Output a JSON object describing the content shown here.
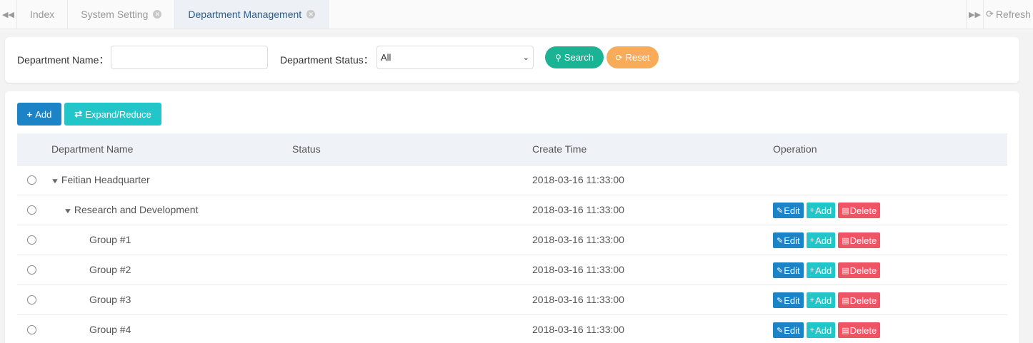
{
  "tabs": {
    "items": [
      {
        "label": "Index",
        "closable": false,
        "active": false
      },
      {
        "label": "System Setting",
        "closable": true,
        "active": false
      },
      {
        "label": "Department Management",
        "closable": true,
        "active": true
      }
    ],
    "refresh_label": "Refresh"
  },
  "search": {
    "dept_name_label": "Department Name：",
    "dept_name_value": "",
    "dept_status_label": "Department Status：",
    "dept_status_selected": "All",
    "search_label": "Search",
    "reset_label": "Reset"
  },
  "toolbar": {
    "add_label": "Add",
    "expand_label": "Expand/Reduce"
  },
  "table": {
    "columns": [
      "Department Name",
      "Status",
      "Create Time",
      "Operation"
    ],
    "rows": [
      {
        "name": "Feitian Headquarter",
        "level": 0,
        "expandable": true,
        "status": "",
        "create_time": "2018-03-16 11:33:00",
        "has_ops": false
      },
      {
        "name": "Research and Development",
        "level": 1,
        "expandable": true,
        "status": "",
        "create_time": "2018-03-16 11:33:00",
        "has_ops": true
      },
      {
        "name": "Group #1",
        "level": 2,
        "expandable": false,
        "status": "",
        "create_time": "2018-03-16 11:33:00",
        "has_ops": true
      },
      {
        "name": "Group #2",
        "level": 2,
        "expandable": false,
        "status": "",
        "create_time": "2018-03-16 11:33:00",
        "has_ops": true
      },
      {
        "name": "Group #3",
        "level": 2,
        "expandable": false,
        "status": "",
        "create_time": "2018-03-16 11:33:00",
        "has_ops": true
      },
      {
        "name": "Group #4",
        "level": 2,
        "expandable": false,
        "status": "",
        "create_time": "2018-03-16 11:33:00",
        "has_ops": true
      }
    ],
    "op_labels": {
      "edit": "Edit",
      "add": "Add",
      "delete": "Delete"
    }
  },
  "colors": {
    "primary": "#1c84c6",
    "info": "#23c6c8",
    "success": "#1ab394",
    "warning": "#f8ac59",
    "danger": "#ed5565"
  }
}
